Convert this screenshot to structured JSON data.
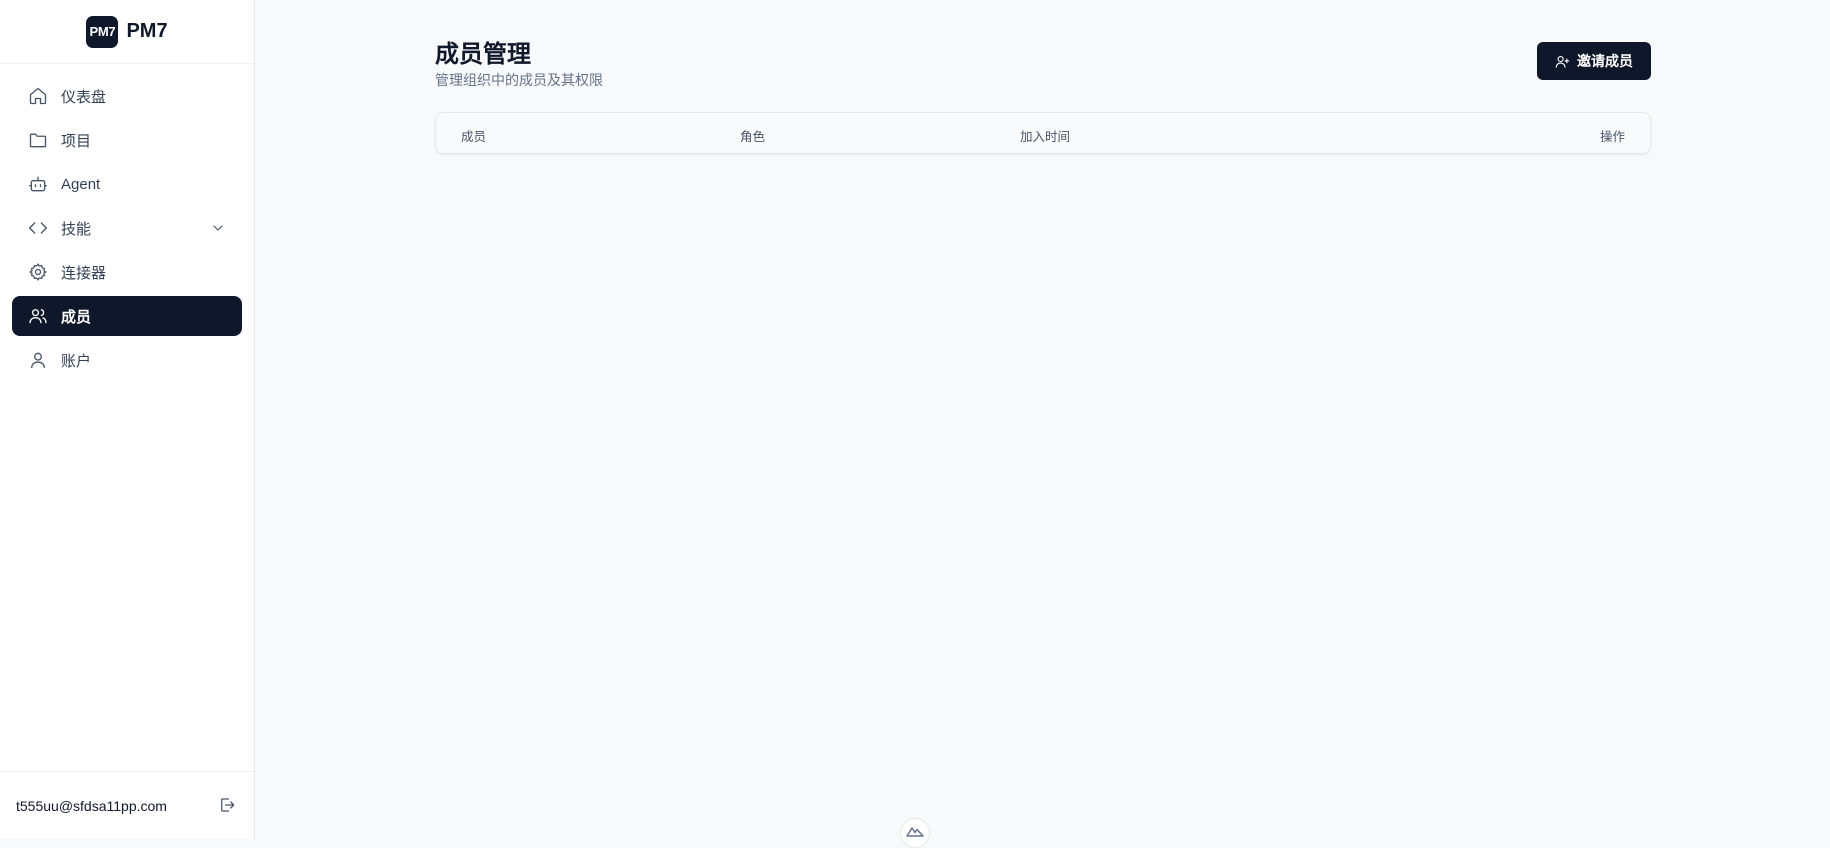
{
  "brand": {
    "logo_text": "PM7",
    "name": "PM7"
  },
  "sidebar": {
    "items": [
      {
        "label": "仪表盘",
        "icon": "home-icon"
      },
      {
        "label": "项目",
        "icon": "folder-icon"
      },
      {
        "label": "Agent",
        "icon": "bot-icon"
      },
      {
        "label": "技能",
        "icon": "code-icon",
        "expandable": true
      },
      {
        "label": "连接器",
        "icon": "gear-icon"
      },
      {
        "label": "成员",
        "icon": "users-icon",
        "active": true
      },
      {
        "label": "账户",
        "icon": "user-icon"
      }
    ]
  },
  "user": {
    "email": "t555uu@sfdsa11pp.com"
  },
  "page": {
    "title": "成员管理",
    "subtitle": "管理组织中的成员及其权限",
    "invite_label": "邀请成员"
  },
  "table": {
    "columns": [
      "成员",
      "角色",
      "加入时间",
      "操作"
    ],
    "rows": []
  },
  "colors": {
    "primary": "#0f172a",
    "background": "#f8f9fb",
    "muted": "#64748b"
  }
}
